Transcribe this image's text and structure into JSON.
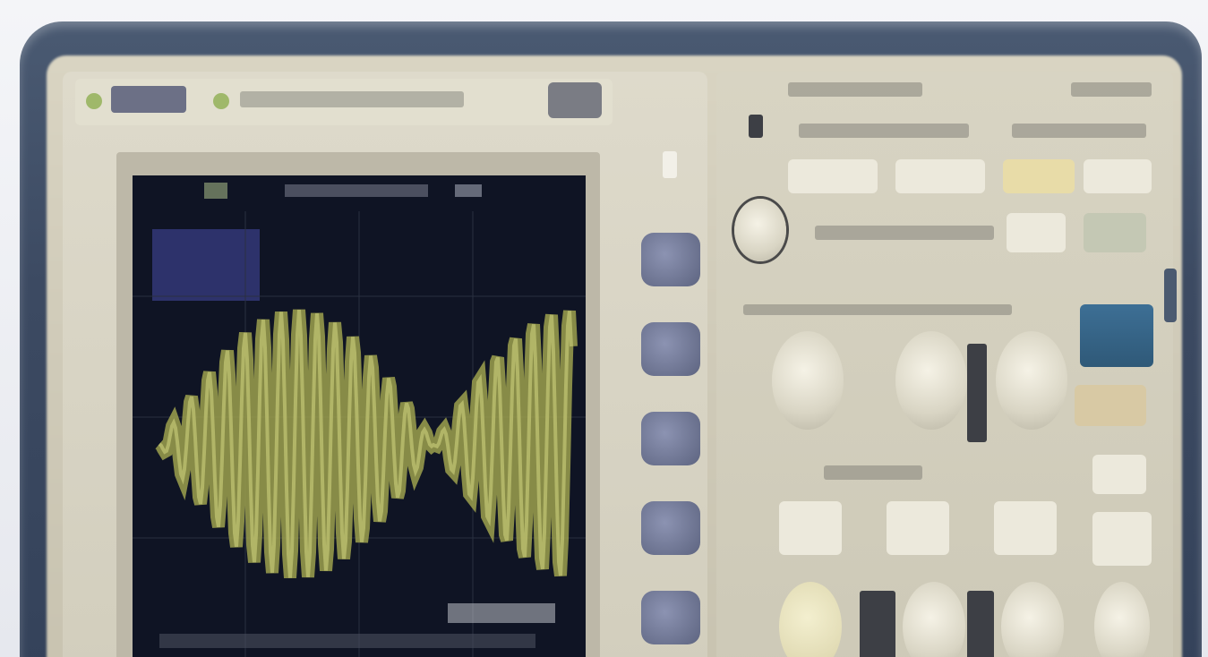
{
  "scene": {
    "subject": "oscilloscope-front-panel",
    "colors": {
      "bezel": "#3c4a62",
      "faceplate": "#d2cebd",
      "screen": "#0f1424",
      "trace": "#9ca04e",
      "accent-blue": "#3d6f95"
    }
  },
  "icons": {
    "brand_logo": "logo-block",
    "key_shape": "rounded-square-button",
    "knob_shape": "round-knob"
  }
}
